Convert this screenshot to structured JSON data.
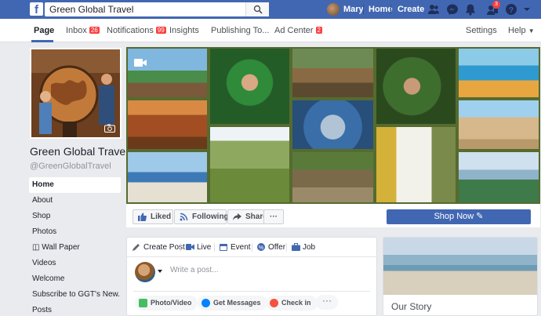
{
  "topbar": {
    "logo_letter": "f",
    "search_value": "Green Global Travel",
    "user_name": "Mary",
    "home_label": "Home",
    "create_label": "Create",
    "notif_badge": "3"
  },
  "pagenav": {
    "items": [
      {
        "label": "Page",
        "badge": ""
      },
      {
        "label": "Inbox",
        "badge": "26"
      },
      {
        "label": "Notifications",
        "badge": "99"
      },
      {
        "label": "Insights",
        "badge": ""
      },
      {
        "label": "Publishing To...",
        "badge": ""
      },
      {
        "label": "Ad Center",
        "badge": "2"
      }
    ],
    "settings_label": "Settings",
    "help_label": "Help"
  },
  "page": {
    "name": "Green Global Travel",
    "handle": "@GreenGlobalTravel"
  },
  "leftnav": {
    "items": [
      "Home",
      "About",
      "Shop",
      "Photos",
      "◫ Wall Paper",
      "Videos",
      "Welcome",
      "Subscribe to GGT's New...",
      "Posts"
    ]
  },
  "actions": {
    "liked_label": "Liked",
    "following_label": "Following",
    "share_label": "Share",
    "more_label": "···",
    "shop_now_label": "Shop Now"
  },
  "composer": {
    "tabs": [
      "Create Post",
      "Live",
      "Event",
      "Offer",
      "Job"
    ],
    "placeholder": "Write a post...",
    "pills": [
      "Photo/Video",
      "Get Messages",
      "Check in"
    ],
    "more_label": "···"
  },
  "story": {
    "title": "Our Story"
  },
  "colors": {
    "brand_blue": "#4267b2",
    "badge_red": "#fa3e3e",
    "background": "#e9ebee"
  }
}
